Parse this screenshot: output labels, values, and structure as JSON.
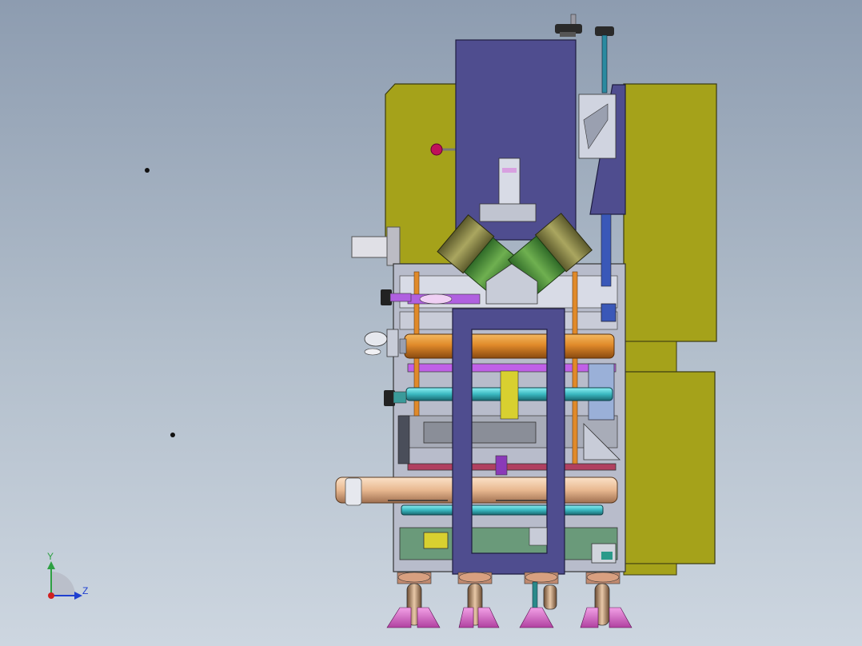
{
  "view": {
    "type": "cad-assembly-side-view",
    "background": [
      "#8d9cb0",
      "#cdd6e0"
    ]
  },
  "triad": {
    "y_label": "Y",
    "z_label": "Z",
    "colors": {
      "y": "#2ea043",
      "z": "#1f3fd0",
      "x": "#d02020"
    }
  },
  "colors": {
    "olive_panel": "#a5a21a",
    "navy_plate": "#4f4d8f",
    "green_motor": "#4f8f3a",
    "khaki_motor": "#8f8a4a",
    "orange_roller": "#e08a2a",
    "teal_shaft": "#3ab8c0",
    "peach_roller": "#e8b890",
    "magenta_caster": "#d060c0",
    "steel_frame": "#c8ccd8",
    "purple_rail": "#b060e0",
    "red_knob": "#c0105a"
  },
  "parts": [
    "left-olive-housing",
    "right-olive-panel-upper",
    "right-olive-panel-lower",
    "top-navy-plate",
    "front-navy-frame",
    "v-motors",
    "orange-roller",
    "teal-shaft-upper",
    "teal-shaft-lower",
    "peach-roller",
    "casters"
  ]
}
